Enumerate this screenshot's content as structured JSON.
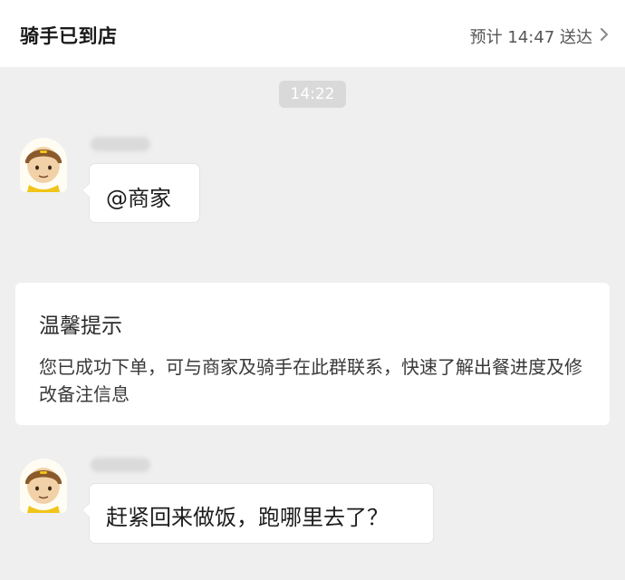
{
  "header": {
    "title": "骑手已到店",
    "eta_text": "预计 14:47 送达",
    "chevron_icon": "chevron-right-icon"
  },
  "chat": {
    "timestamp": "14:22",
    "messages": [
      {
        "sender_avatar_icon": "rider-avatar-icon",
        "text": "@商家"
      },
      {
        "sender_avatar_icon": "rider-avatar-icon",
        "text": "赶紧回来做饭，跑哪里去了？"
      }
    ],
    "notice": {
      "title": "温馨提示",
      "body": "您已成功下单，可与商家及骑手在此群联系，快速了解出餐进度及修改备注信息"
    }
  },
  "colors": {
    "background": "#efefef",
    "bubble": "#ffffff",
    "avatar_helmet": "#8a5a2b",
    "avatar_accent": "#f0c419"
  }
}
